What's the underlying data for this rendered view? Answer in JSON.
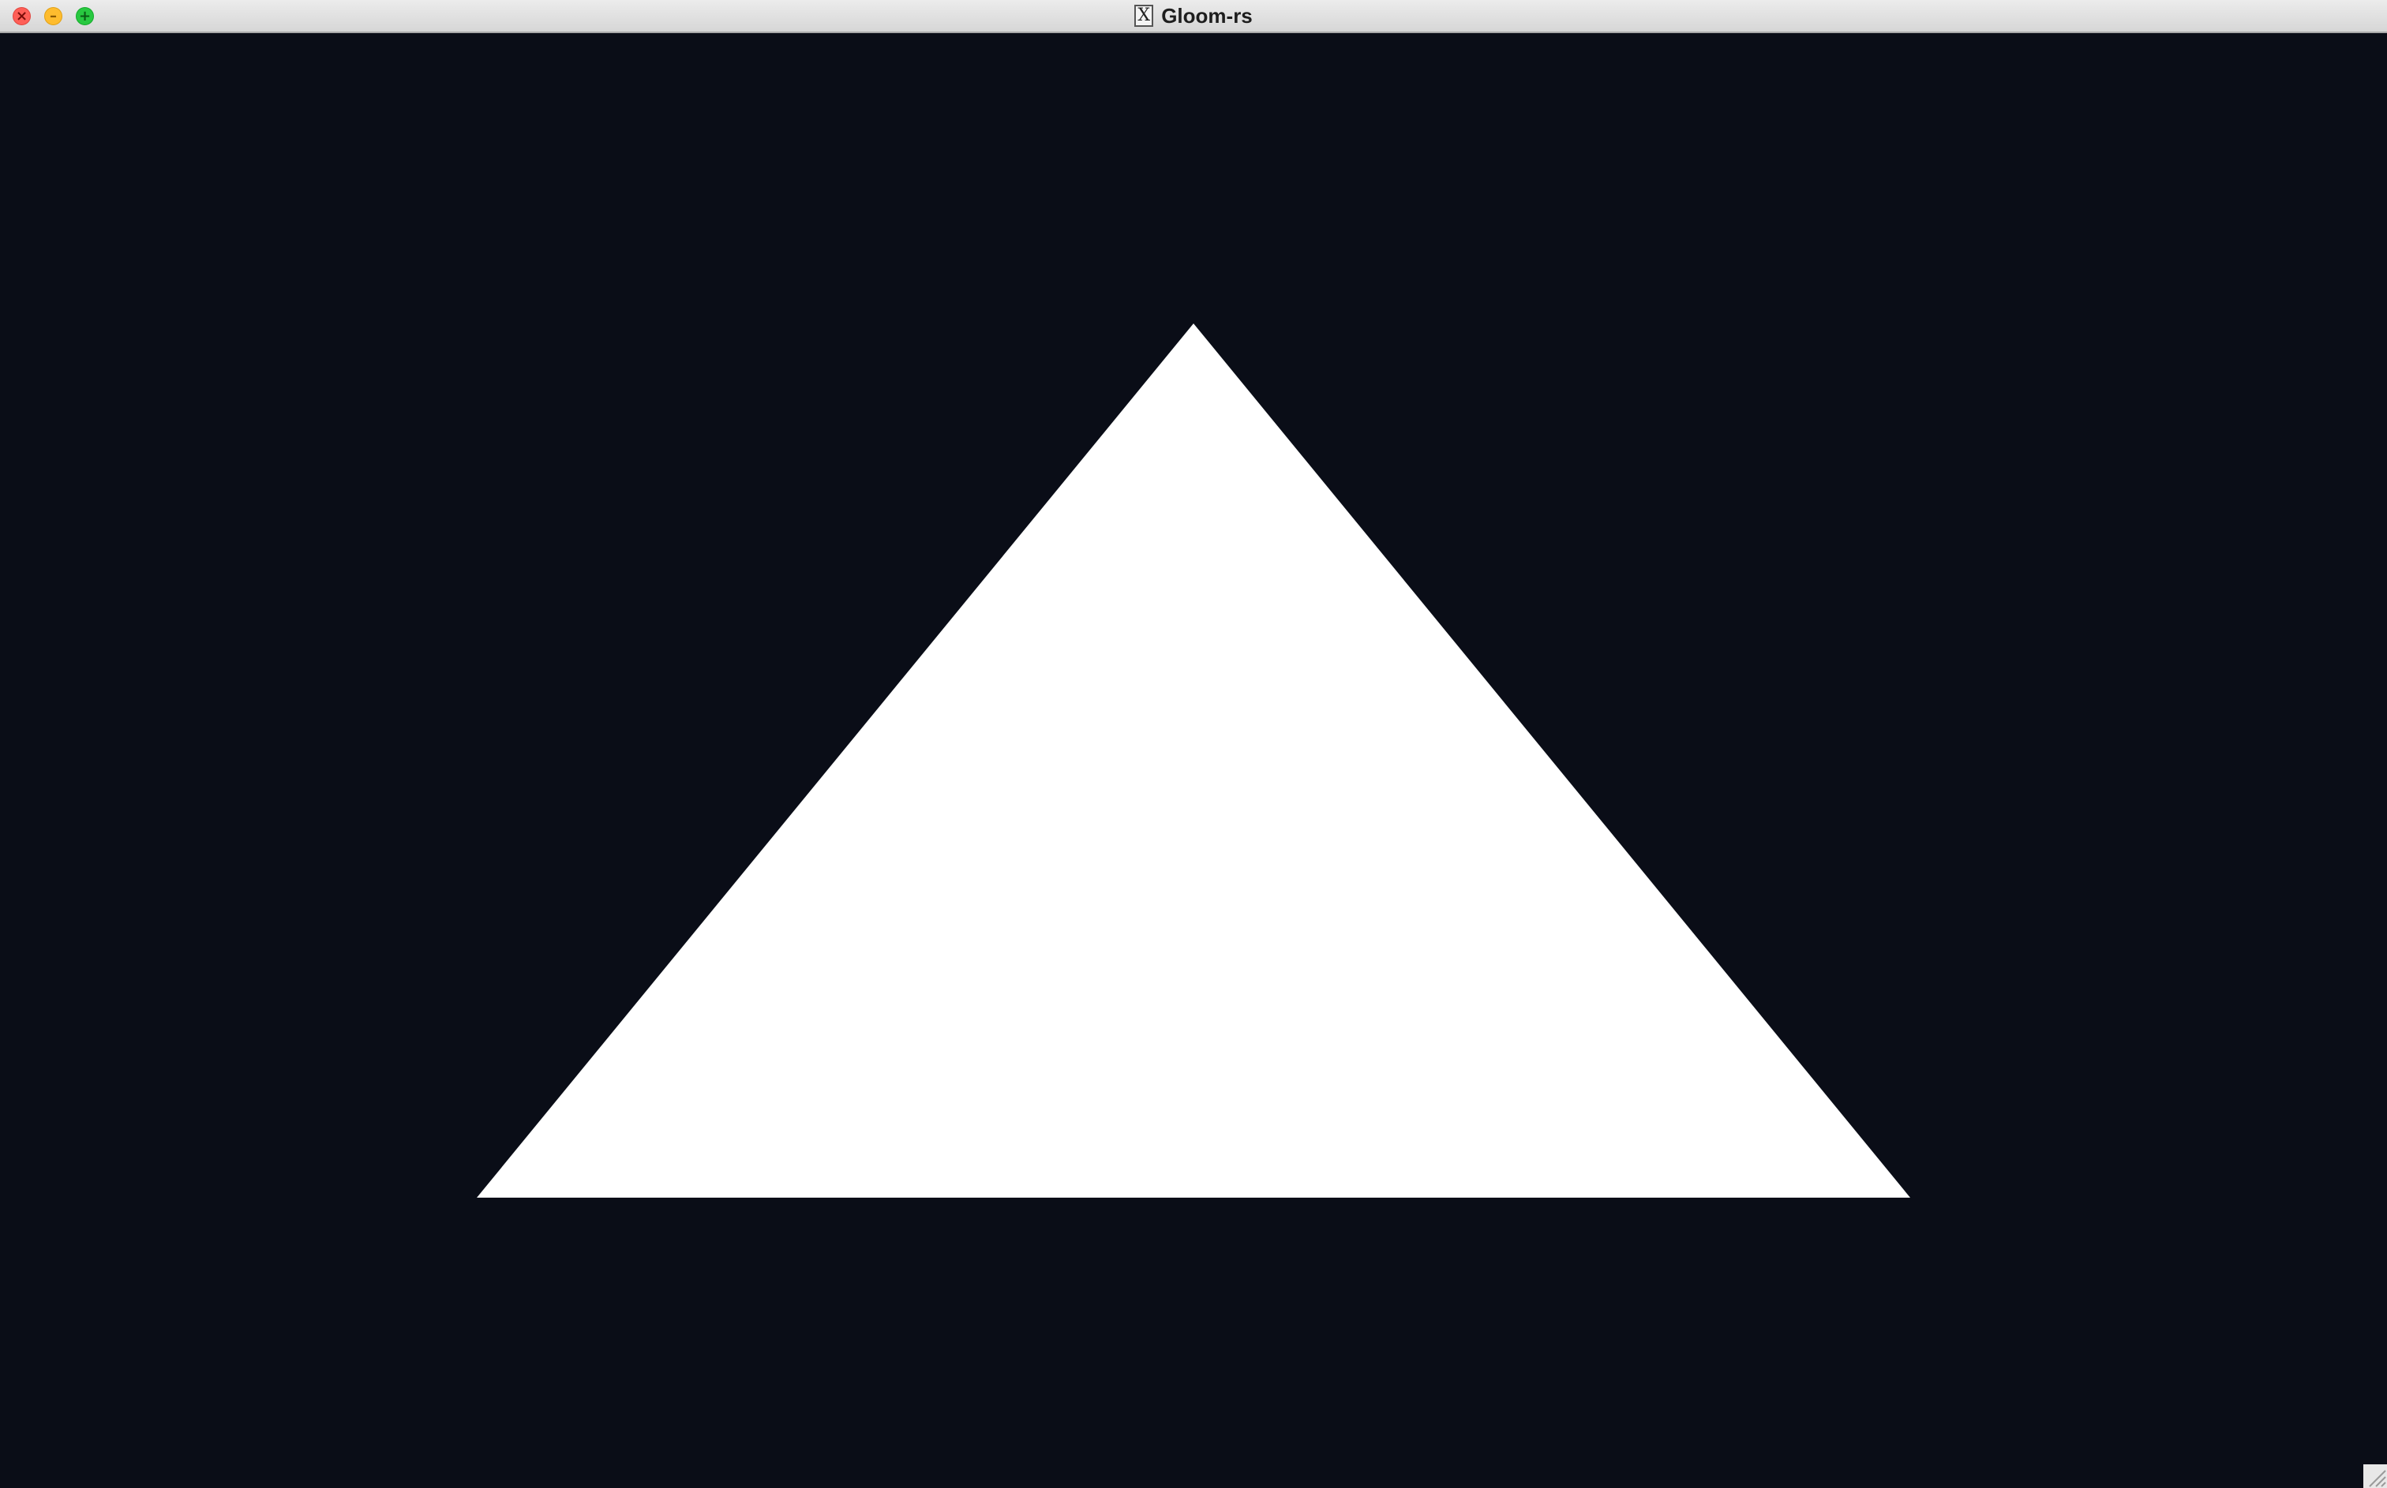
{
  "window": {
    "title": "Gloom-rs",
    "app_icon": "x11-icon",
    "app_icon_glyph": "X",
    "close_glyph": "×",
    "minimize_glyph": "–",
    "maximize_glyph": "+"
  },
  "canvas": {
    "background_color": "#0a0d17",
    "shape": "triangle",
    "shape_color": "#ffffff"
  },
  "colors": {
    "close": "#fe5f57",
    "minimize": "#febc2e",
    "maximize": "#28c840",
    "titlebar": "#e3e3e3"
  }
}
